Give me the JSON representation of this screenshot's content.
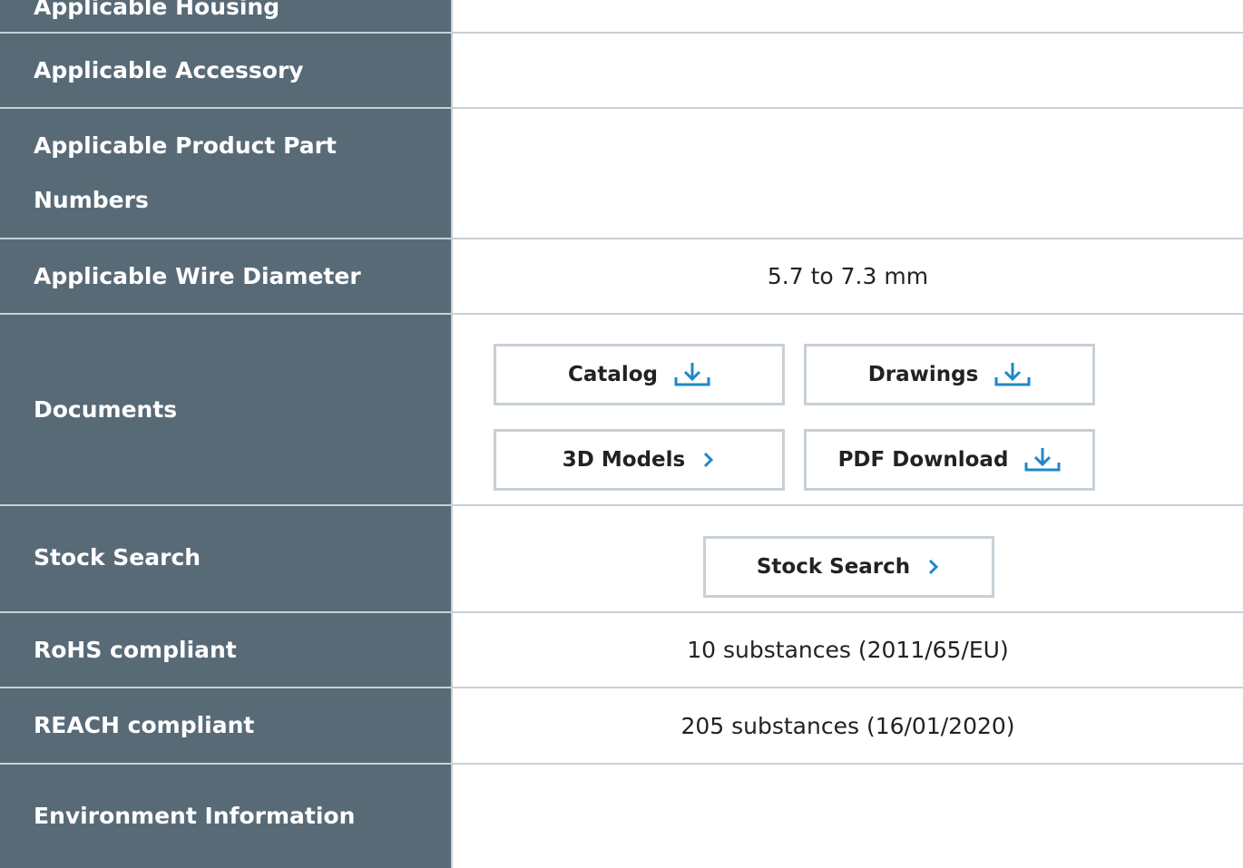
{
  "rows": {
    "top_partial": {
      "label": "Applicable Housing"
    },
    "accessory": {
      "label": "Applicable Accessory",
      "value": ""
    },
    "part_numbers": {
      "label_line1": "Applicable Product Part",
      "label_line2": "Numbers",
      "value": ""
    },
    "wire_diameter": {
      "label": "Applicable Wire Diameter",
      "value": "5.7 to 7.3 mm"
    },
    "documents": {
      "label": "Documents",
      "buttons": {
        "catalog": "Catalog",
        "drawings": "Drawings",
        "models_3d": "3D Models",
        "pdf": "PDF Download"
      }
    },
    "stock_search": {
      "label": "Stock Search",
      "button": "Stock Search"
    },
    "rohs": {
      "label": "RoHS compliant",
      "value": "10 substances (2011/65/EU)"
    },
    "reach": {
      "label": "REACH compliant",
      "value": "205 substances (16/01/2020)"
    },
    "environment": {
      "label": "Environment Information",
      "value": ""
    }
  },
  "icons": {
    "download": "download-icon",
    "chevron": "chevron-right-icon"
  },
  "colors": {
    "label_bg": "#596a77",
    "accent": "#1e88c8",
    "border": "#c7d0d7"
  }
}
